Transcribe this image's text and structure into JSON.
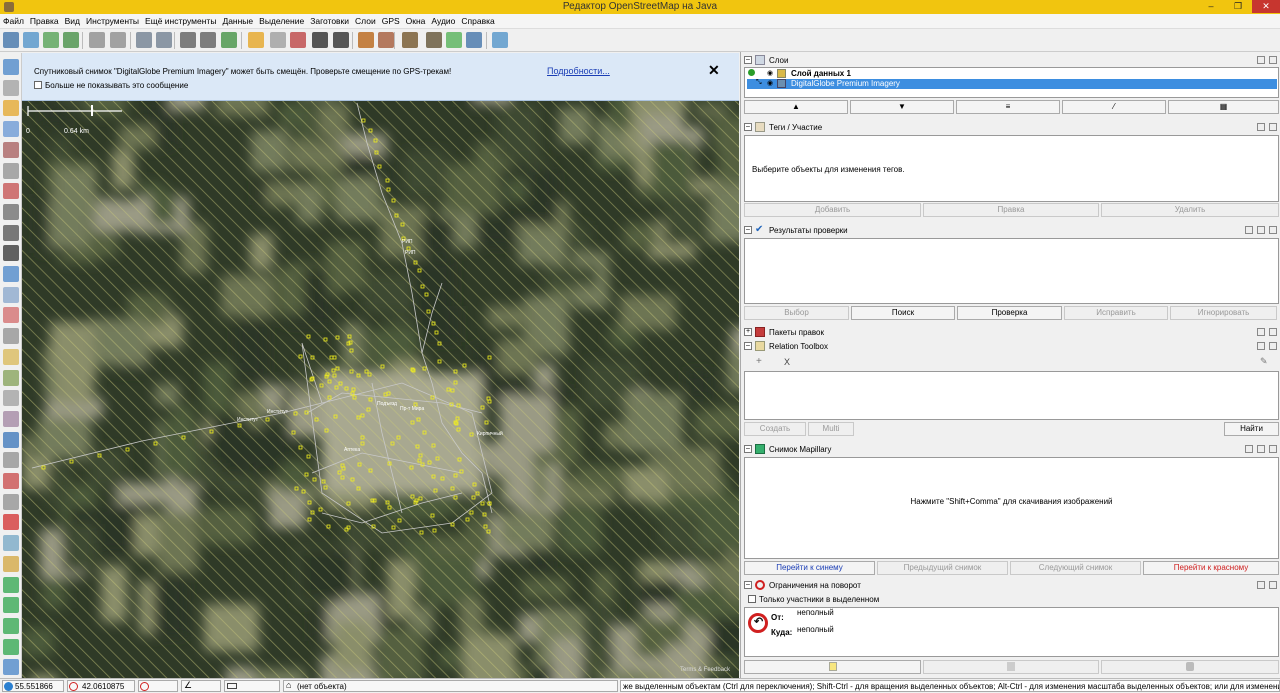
{
  "window": {
    "title": "Редактор OpenStreetMap на Java",
    "minimize": "–",
    "maximize": "❐",
    "close": "✕"
  },
  "menu": [
    "Файл",
    "Правка",
    "Вид",
    "Инструменты",
    "Ещё инструменты",
    "Данные",
    "Выделение",
    "Заготовки",
    "Слои",
    "GPS",
    "Окна",
    "Аудио",
    "Справка"
  ],
  "notice": {
    "message": "Спутниковый снимок \"DigitalGlobe Premium Imagery\" может быть смещён. Проверьте смещение по GPS-трекам!",
    "link": "Подробности...",
    "close": "✕",
    "checkbox_label": "Больше не показывать это сообщение"
  },
  "map": {
    "scale_start": "0",
    "scale_end": "0.64 km",
    "terms": "Terms & Feedback"
  },
  "map_labels": [
    "Институт",
    "Институт",
    "РИП",
    "РИП",
    "Подъезд",
    "Пр-т Мира",
    "Аптека",
    "Кирпичный"
  ],
  "layers": {
    "title": "Слои",
    "rows": [
      {
        "name": "Слой данных 1",
        "selected": false
      },
      {
        "name": "DigitalGlobe Premium Imagery",
        "selected": true
      }
    ],
    "buttons": [
      "▲",
      "▼",
      "≡",
      "⁄",
      "▦"
    ]
  },
  "tags": {
    "title": "Теги / Участие",
    "empty": "Выберите объекты для изменения тегов.",
    "buttons": [
      "Добавить",
      "Правка",
      "Удалить"
    ]
  },
  "validation": {
    "title": "Результаты проверки",
    "buttons": [
      "Выбор",
      "Поиск",
      "Проверка",
      "Исправить",
      "Игнорировать"
    ]
  },
  "changesets": {
    "title": "Пакеты правок"
  },
  "relation": {
    "title": "Relation Toolbox",
    "top_buttons": [
      "+",
      "X"
    ],
    "buttons": [
      "Создать",
      "Multi",
      "Найти"
    ]
  },
  "mapillary": {
    "title": "Снимок Mapillary",
    "hint": "Нажмите \"Shift+Comma\" для скачивания изображений",
    "buttons": [
      "Перейти к синему",
      "Предыдущий снимок",
      "Следующий снимок",
      "Перейти к красному"
    ]
  },
  "turn": {
    "title": "Ограничения на поворот",
    "checkbox": "Только участники в выделенном",
    "from_label": "От:",
    "from_value": "неполный",
    "to_label": "Куда:",
    "to_value": "неполный"
  },
  "status": {
    "lat": "55.551866",
    "lon": "42.0610875",
    "object": "(нет объекта)",
    "hint": "же выделенным объектам (Ctrl для переключения); Shift-Ctrl - для вращения выделенных объектов; Alt-Ctrl - для изменения масштаба выделенных объектов; или для изменения выделения"
  },
  "colors": {
    "titlebar": "#f1c50f",
    "selection": "#3d8ee0",
    "accent_blue": "#1a3db5",
    "accent_red": "#d02020"
  }
}
